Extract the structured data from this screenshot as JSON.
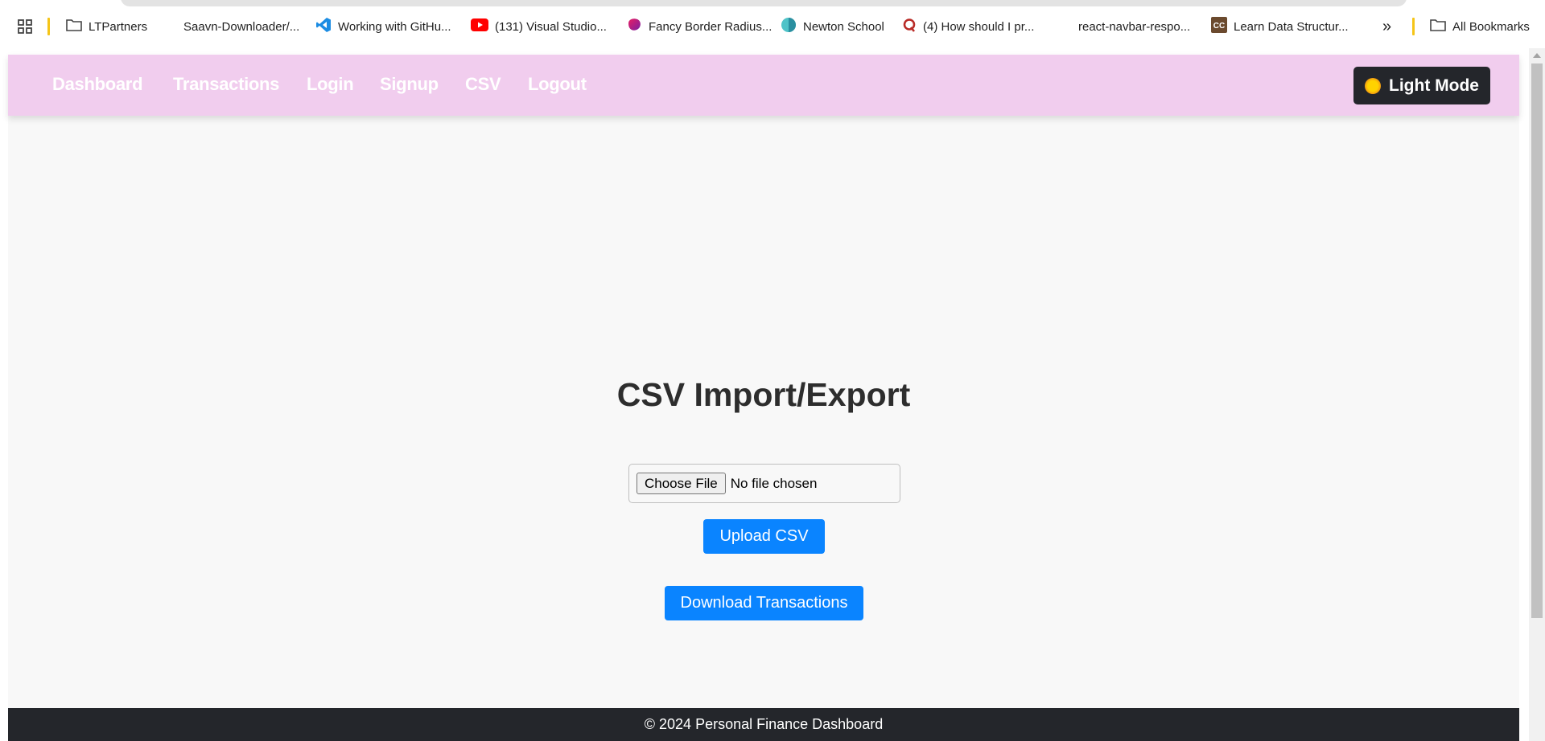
{
  "bookmarks": {
    "items": [
      {
        "label": "LTPartners",
        "icon": "folder-icon"
      },
      {
        "label": "Saavn-Downloader/...",
        "icon": "none"
      },
      {
        "label": "Working with GitHu...",
        "icon": "vscode-icon"
      },
      {
        "label": "(131) Visual Studio...",
        "icon": "youtube-icon"
      },
      {
        "label": "Fancy Border Radius...",
        "icon": "blob-icon"
      },
      {
        "label": "Newton School",
        "icon": "newton-icon"
      },
      {
        "label": "(4) How should I pr...",
        "icon": "quora-icon"
      },
      {
        "label": "react-navbar-respo...",
        "icon": "none"
      },
      {
        "label": "Learn Data Structur...",
        "icon": "cc-icon"
      }
    ],
    "overflow": "»",
    "all_bookmarks": "All Bookmarks"
  },
  "navbar": {
    "links": [
      "Dashboard",
      "Transactions",
      "Login",
      "Signup",
      "CSV",
      "Logout"
    ],
    "mode_button": "Light Mode",
    "background": "#f1cdee"
  },
  "main": {
    "title": "CSV Import/Export",
    "file_button": "Choose File",
    "file_status": "No file chosen",
    "upload_button": "Upload CSV",
    "download_button": "Download Transactions",
    "accent_color": "#0a84ff"
  },
  "footer": {
    "text": "© 2024 Personal Finance Dashboard"
  }
}
